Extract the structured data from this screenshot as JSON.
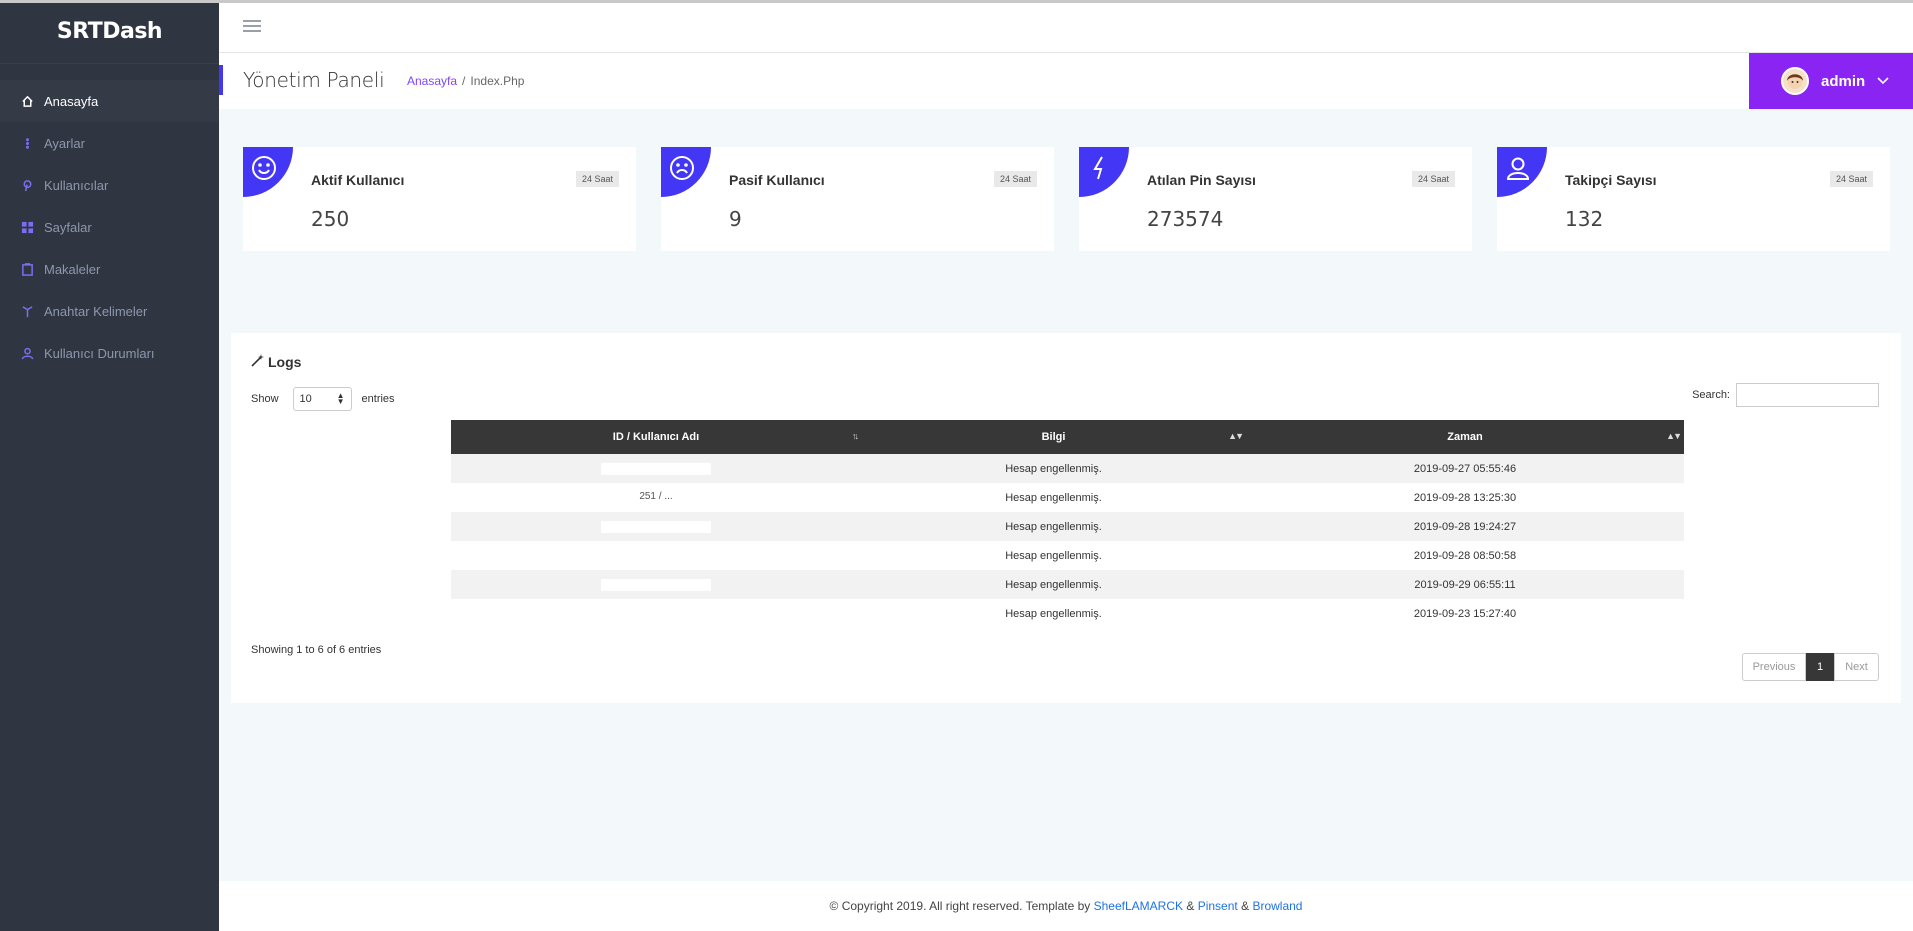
{
  "brand": "SRTDash",
  "sidebar": {
    "items": [
      {
        "label": "Anasayfa",
        "icon": "home-icon",
        "active": true
      },
      {
        "label": "Ayarlar",
        "icon": "more-vertical-icon"
      },
      {
        "label": "Kullanıcılar",
        "icon": "pinterest-icon"
      },
      {
        "label": "Sayfalar",
        "icon": "grid-icon"
      },
      {
        "label": "Makaleler",
        "icon": "clipboard-icon"
      },
      {
        "label": "Anahtar Kelimeler",
        "icon": "key-icon"
      },
      {
        "label": "Kullanıcı Durumları",
        "icon": "user-icon"
      }
    ]
  },
  "header": {
    "title": "Yönetim Paneli",
    "breadcrumb_home": "Anasayfa",
    "breadcrumb_sep": "/",
    "breadcrumb_current": "Index.Php",
    "user": "admin"
  },
  "cards": [
    {
      "title": "Aktif Kullanıcı",
      "badge": "24 Saat",
      "value": "250",
      "icon": "smile-icon"
    },
    {
      "title": "Pasif Kullanıcı",
      "badge": "24 Saat",
      "value": "9",
      "icon": "frown-icon"
    },
    {
      "title": "Atılan Pin Sayısı",
      "badge": "24 Saat",
      "value": "273574",
      "icon": "bolt-icon"
    },
    {
      "title": "Takipçi Sayısı",
      "badge": "24 Saat",
      "value": "132",
      "icon": "user-icon"
    }
  ],
  "logs": {
    "title": "Logs",
    "show_label": "Show",
    "entries_label": "entries",
    "page_size": "10",
    "search_label": "Search:",
    "columns": [
      "ID / Kullanıcı Adı",
      "Bilgi",
      "Zaman"
    ],
    "rows": [
      {
        "id": "",
        "info": "Hesap engellenmiş.",
        "time": "2019-09-27 05:55:46"
      },
      {
        "id": "251 / ...",
        "info": "Hesap engellenmiş.",
        "time": "2019-09-28 13:25:30"
      },
      {
        "id": "",
        "info": "Hesap engellenmiş.",
        "time": "2019-09-28 19:24:27"
      },
      {
        "id": "",
        "info": "Hesap engellenmiş.",
        "time": "2019-09-28 08:50:58"
      },
      {
        "id": "",
        "info": "Hesap engellenmiş.",
        "time": "2019-09-29 06:55:11"
      },
      {
        "id": "",
        "info": "Hesap engellenmiş.",
        "time": "2019-09-23 15:27:40"
      }
    ],
    "showing": "Showing 1 to 6 of 6 entries",
    "prev": "Previous",
    "page": "1",
    "next": "Next"
  },
  "footer": {
    "text": "© Copyright 2019. All right reserved. Template by",
    "link1": "SheefLAMARCK",
    "amp1": "&",
    "link2": "Pinsent",
    "amp2": "&",
    "link3": "Browland"
  },
  "colors": {
    "sidebar_bg": "#303641",
    "accent": "#4336f4",
    "user_menu": "#8a24f2",
    "table_header": "#373737"
  }
}
